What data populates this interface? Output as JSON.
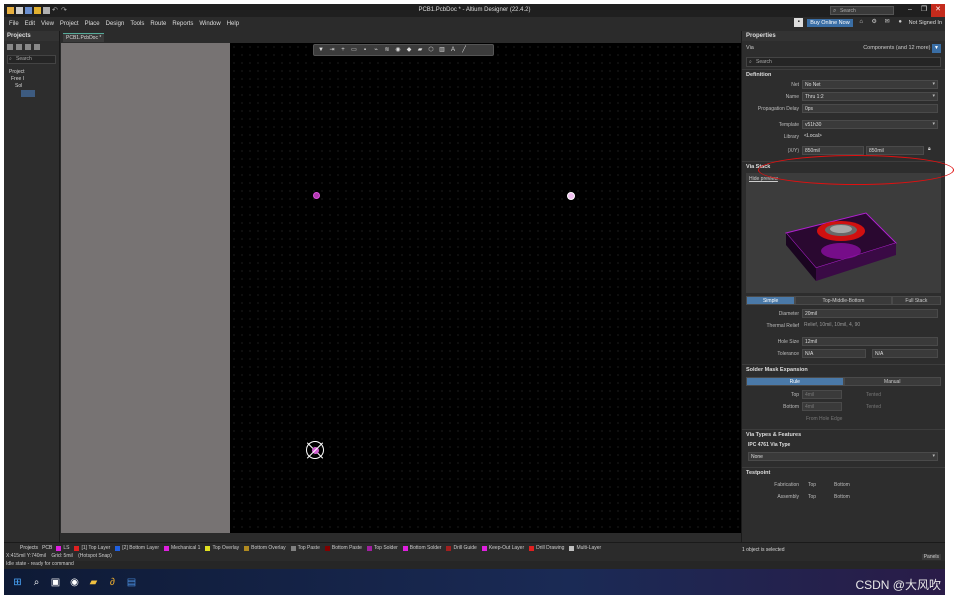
{
  "app": {
    "title": "PCB1.PcbDoc * - Altium Designer (22.4.2)",
    "search_placeholder": "Search"
  },
  "menu": [
    "File",
    "Edit",
    "View",
    "Project",
    "Place",
    "Design",
    "Tools",
    "Route",
    "Reports",
    "Window",
    "Help"
  ],
  "menu_right": {
    "buy": "Buy Online Now",
    "user": "Not Signed In"
  },
  "projects": {
    "title": "Projects",
    "search": "Search",
    "tree": [
      "Project",
      "Free I",
      "Sol"
    ]
  },
  "doc_tab": "PCB1.PcbDoc *",
  "props": {
    "title": "Properties",
    "object": "Via",
    "filter_text": "Components (and 12 more)",
    "search": "Search",
    "definition": {
      "title": "Definition",
      "net_label": "Net",
      "net": "No Net",
      "name_label": "Name",
      "name": "Thru 1:2",
      "delay_label": "Propagation Delay",
      "delay": "0ps",
      "template_label": "Template",
      "template": "v51h30",
      "library_label": "Library",
      "library": "<Local>",
      "xy_label": "(X/Y)",
      "x": "850mil",
      "y": "850mil"
    },
    "via_stack": {
      "title": "Via Stack",
      "hide_preview": "Hide preview",
      "modes": [
        "Simple",
        "Top-Middle-Bottom",
        "Full Stack"
      ],
      "diameter_label": "Diameter",
      "diameter": "20mil",
      "thermal_label": "Thermal Relief",
      "thermal": "Relief, 10mil, 10mil, 4, 90",
      "hole_label": "Hole Size",
      "hole": "12mil",
      "tol_label": "Tolerance",
      "tol_plus": "N/A",
      "tol_minus": "N/A"
    },
    "solder": {
      "title": "Solder Mask Expansion",
      "modes": [
        "Rule",
        "Manual"
      ],
      "top_label": "Top",
      "top": "4mil",
      "bottom_label": "Bottom",
      "bottom": "4mil",
      "tented": "Tented",
      "from_hole": "From Hole Edge"
    },
    "via_types": {
      "title": "Via Types & Features",
      "ipc": "IPC 4761 Via Type",
      "value": "None"
    },
    "testpoint": {
      "title": "Testpoint",
      "fab": "Fabrication",
      "asm": "Assembly",
      "top": "Top",
      "bottom": "Bottom"
    },
    "selected": "1 object is selected"
  },
  "layers": [
    {
      "name": "LS",
      "color": "#e01ee0"
    },
    {
      "name": "[1] Top Layer",
      "color": "#e02020"
    },
    {
      "name": "[2] Bottom Layer",
      "color": "#2060e0"
    },
    {
      "name": "Mechanical 1",
      "color": "#e020e0"
    },
    {
      "name": "Top Overlay",
      "color": "#e0e020"
    },
    {
      "name": "Bottom Overlay",
      "color": "#b08a20"
    },
    {
      "name": "Top Paste",
      "color": "#808080"
    },
    {
      "name": "Bottom Paste",
      "color": "#800000"
    },
    {
      "name": "Top Solder",
      "color": "#a020a0"
    },
    {
      "name": "Bottom Solder",
      "color": "#e020e0"
    },
    {
      "name": "Drill Guide",
      "color": "#a02020"
    },
    {
      "name": "Keep-Out Layer",
      "color": "#e020e0"
    },
    {
      "name": "Drill Drawing",
      "color": "#e02020"
    },
    {
      "name": "Multi-Layer",
      "color": "#c0c0c0"
    }
  ],
  "status": {
    "tabs": [
      "Projects",
      "PCB"
    ],
    "coords": "X:415mil Y:740mil",
    "grid": "Grid: 5mil",
    "snap": "(Hotspot Snap)",
    "idle": "Idle state - ready for command",
    "panels": "Panels"
  },
  "watermark": "CSDN @大风吹"
}
